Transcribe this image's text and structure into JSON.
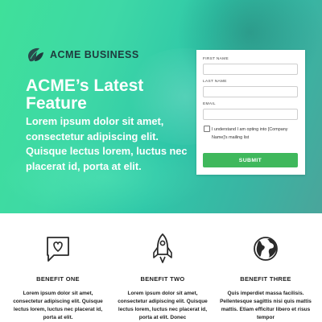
{
  "brand": {
    "name": "ACME BUSINESS"
  },
  "hero": {
    "title": "ACME’s Latest Feature",
    "body": "Lorem ipsum dolor sit amet, consectetur adipiscing elit. Quisque lectus lorem, luctus nec placerat id, porta at elit."
  },
  "form": {
    "first_name_label": "FIRST NAME",
    "last_name_label": "LAST NAME",
    "email_label": "EMAIL",
    "consent_text": "I understand I am opting into [Company Name]'s mailing list",
    "submit_label": "SUBMIT"
  },
  "benefits": [
    {
      "title": "BENEFIT ONE",
      "icon": "chat-heart-icon",
      "text": "Lorem ipsum dolor sit amet, consectetur adipiscing elit. Quisque lectus lorem, luctus nec placerat id, porta at elit."
    },
    {
      "title": "BENEFIT TWO",
      "icon": "rocket-icon",
      "text": "Lorem ipsum dolor sit amet, consectetur adipiscing elit. Quisque lectus lorem, luctus nec placerat id, porta at elit. Donec"
    },
    {
      "title": "BENEFIT THREE",
      "icon": "globe-icon",
      "text": "Quis imperdiet massa facilisis. Pellentesque sagittis nisi quis mattis mattis. Etiam efficitur libero et risus tempor"
    }
  ],
  "colors": {
    "accent": "#3fb85c",
    "hero_start": "#3fe09a",
    "hero_end": "#4aa59b",
    "logo_text": "#1e3a3d"
  }
}
